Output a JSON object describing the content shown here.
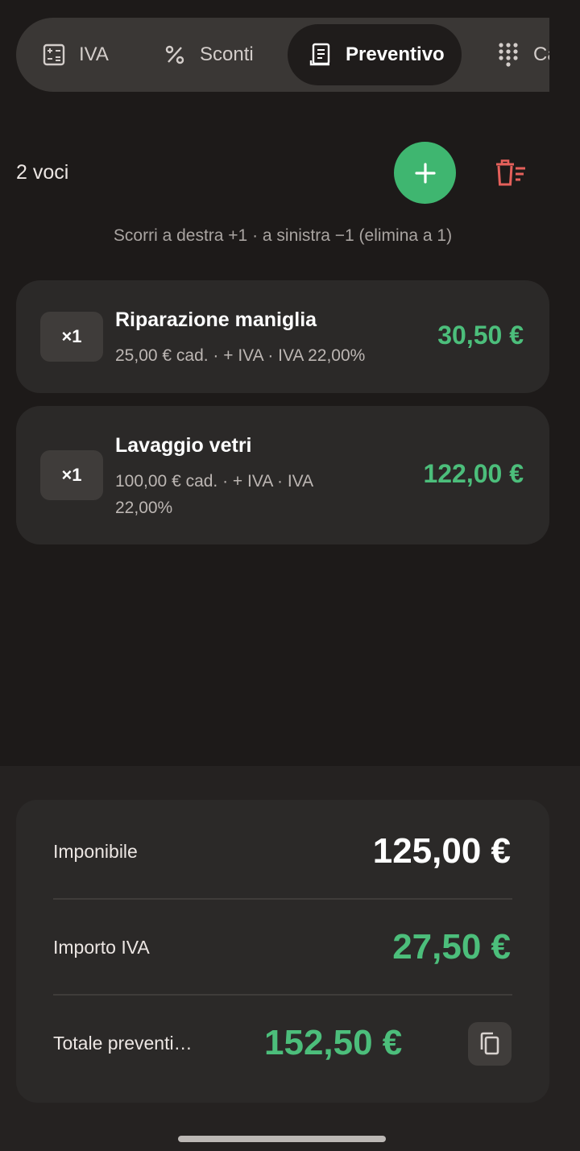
{
  "tabs": [
    {
      "label": "IVA",
      "icon": "calculator-icon",
      "selected": false
    },
    {
      "label": "Sconti",
      "icon": "percent-icon",
      "selected": false
    },
    {
      "label": "Preventivo",
      "icon": "receipt-icon",
      "selected": true
    },
    {
      "label": "Ca",
      "icon": "keypad-icon",
      "selected": false
    }
  ],
  "header": {
    "count": "2 voci",
    "hint": "Scorri a destra +1 · a sinistra −1 (elimina a 1)",
    "add_icon": "plus-icon",
    "clear_icon": "delete-list-icon"
  },
  "items": [
    {
      "qty": "×1",
      "name": "Riparazione maniglia",
      "details": "25,00 € cad. · + IVA · IVA 22,00%",
      "price": "30,50 €"
    },
    {
      "qty": "×1",
      "name": "Lavaggio vetri",
      "details": "100,00 € cad. · + IVA · IVA 22,00%",
      "price": "122,00 €"
    }
  ],
  "totals": {
    "imponibile_label": "Imponibile",
    "imponibile_value": "125,00 €",
    "iva_label": "Importo IVA",
    "iva_value": "27,50 €",
    "totale_label": "Totale preventi…",
    "totale_value": "152,50 €",
    "copy_icon": "copy-icon"
  },
  "colors": {
    "background": "#1d1a19",
    "card": "#2b2928",
    "accent_green": "#3fb670",
    "price_green": "#4cbe7b",
    "delete_red": "#e5605b"
  }
}
